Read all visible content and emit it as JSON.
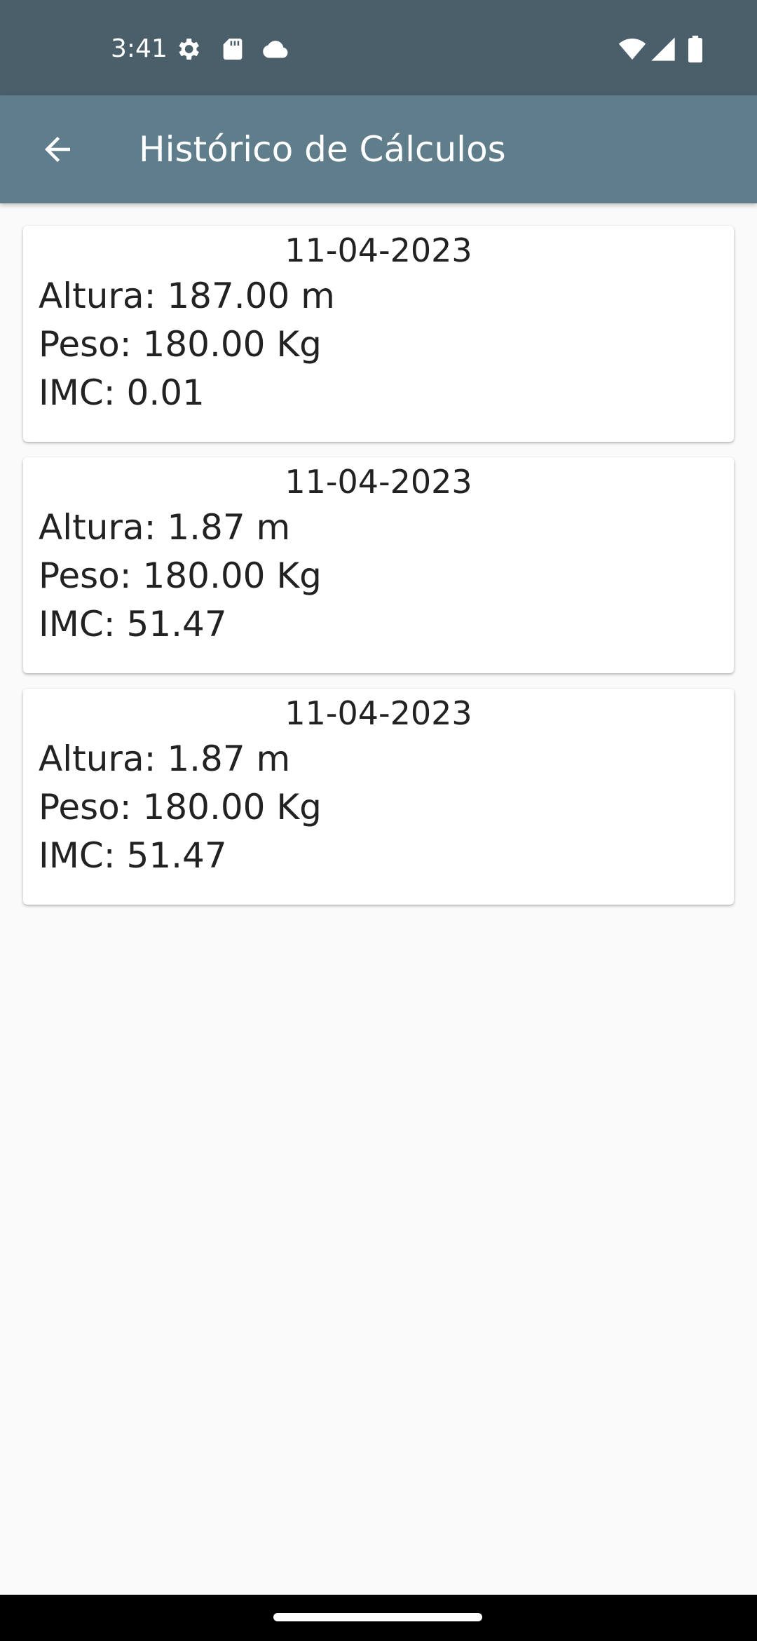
{
  "status_bar": {
    "time": "3:41",
    "icons": [
      "settings-icon",
      "sd-card-icon",
      "cloud-icon",
      "wifi-icon",
      "cell-signal-icon",
      "battery-icon"
    ]
  },
  "app_bar": {
    "title": "Histórico de Cálculos",
    "back_icon": "arrow-back-icon"
  },
  "records": [
    {
      "date": "11-04-2023",
      "altura": "Altura: 187.00 m",
      "peso": "Peso: 180.00 Kg",
      "imc": "IMC: 0.01"
    },
    {
      "date": "11-04-2023",
      "altura": "Altura: 1.87 m",
      "peso": "Peso: 180.00 Kg",
      "imc": "IMC: 51.47"
    },
    {
      "date": "11-04-2023",
      "altura": "Altura: 1.87 m",
      "peso": "Peso: 180.00 Kg",
      "imc": "IMC: 51.47"
    }
  ],
  "colors": {
    "status_bar": "#4a5f6a",
    "app_bar": "#607d8b",
    "background": "#fafafa",
    "card": "#ffffff",
    "text": "#222222"
  }
}
